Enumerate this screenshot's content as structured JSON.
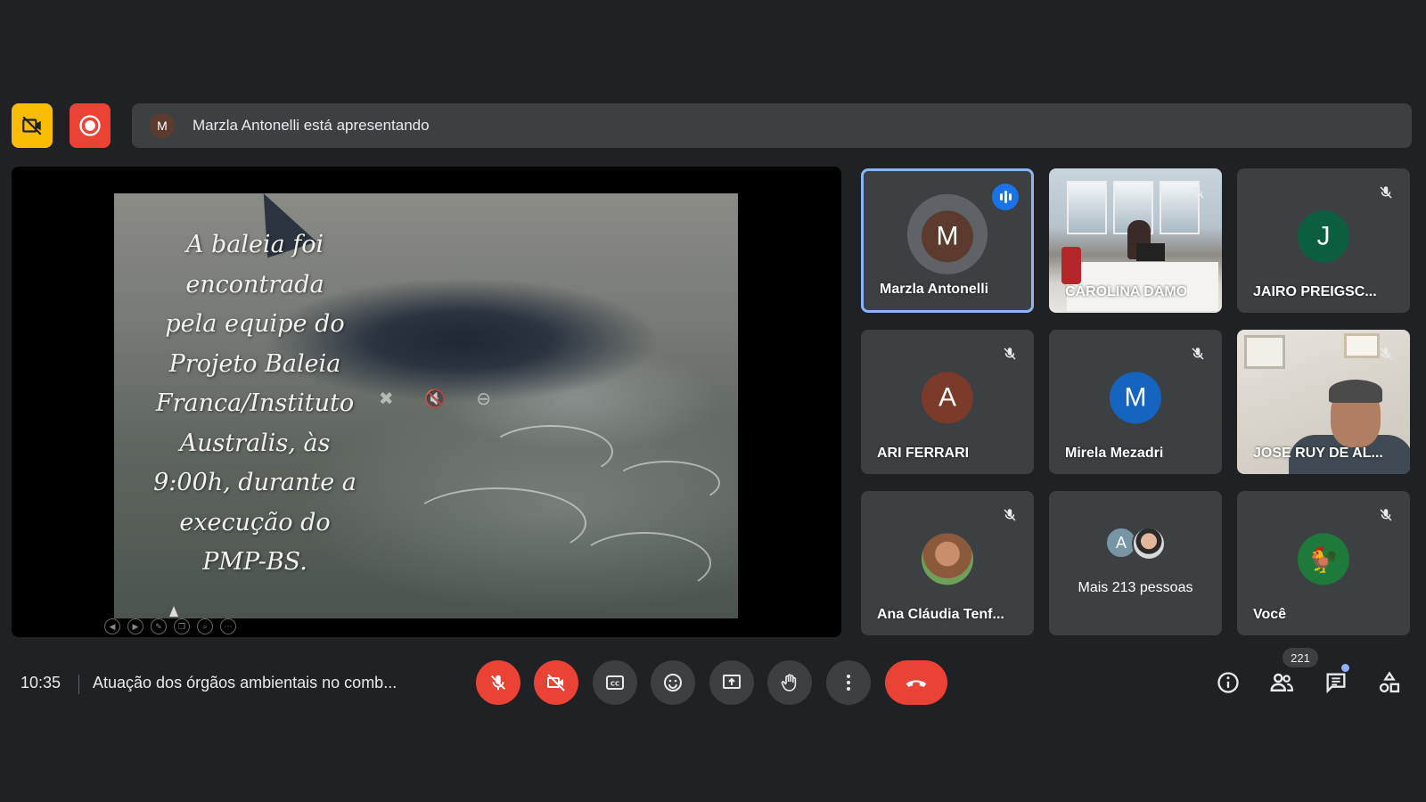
{
  "top_bar": {
    "presenter_initial": "M",
    "presenting_text": "Marzla Antonelli está apresentando"
  },
  "slide": {
    "text_lines": [
      "A baleia foi",
      "encontrada",
      "pela equipe do",
      "Projeto Baleia",
      "Franca/Instituto",
      "Australis, às",
      "9:00h, durante a",
      "execução do",
      "PMP-BS."
    ]
  },
  "participants": [
    {
      "name": "Marzla Antonelli",
      "initial": "M",
      "color": "#5d3a2e",
      "status": "speaking"
    },
    {
      "name": "CAROLINA DAMO",
      "status": "muted",
      "video": "office"
    },
    {
      "name": "JAIRO PREIGSC...",
      "initial": "J",
      "color": "#0b5e3f",
      "status": "muted"
    },
    {
      "name": "ARI FERRARI",
      "initial": "A",
      "color": "#7b3a2a",
      "status": "muted"
    },
    {
      "name": "Mirela Mezadri",
      "initial": "M",
      "color": "#1565c0",
      "status": "muted"
    },
    {
      "name": "JOSE RUY DE AL...",
      "status": "muted",
      "video": "man"
    },
    {
      "name": "Ana Cláudia Tenf...",
      "status": "muted",
      "avatar": "photo"
    },
    {
      "more_initial": "A",
      "more_text": "Mais 213 pessoas"
    },
    {
      "name": "Você",
      "status": "muted",
      "avatar": "rooster"
    }
  ],
  "bottom_bar": {
    "time": "10:35",
    "meeting_title": "Atuação dos órgãos ambientais no comb...",
    "participant_count": "221"
  },
  "icons": {
    "no_camera": "camera-off-icon",
    "recording": "record-icon",
    "mic_off": "mic-off-icon",
    "cam_off": "video-off-icon",
    "captions": "captions-icon",
    "emoji": "emoji-icon",
    "present": "present-icon",
    "raise_hand": "hand-icon",
    "more": "more-vert-icon",
    "end_call": "call-end-icon",
    "info": "info-icon",
    "people": "people-icon",
    "chat": "chat-icon",
    "activities": "activities-icon"
  },
  "colors": {
    "background": "#202124",
    "surface": "#3c4043",
    "danger": "#ea4335",
    "accent": "#8ab4f8",
    "warning": "#fbbc04"
  }
}
